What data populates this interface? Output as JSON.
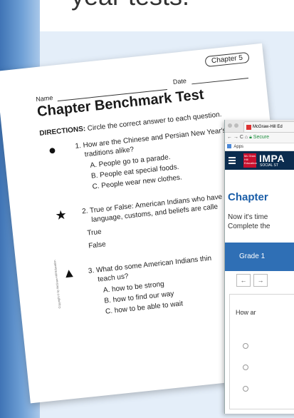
{
  "header_partial": "year tests.",
  "worksheet": {
    "chapter_tag": "Chapter 5",
    "date_label": "Date",
    "name_label": "Name",
    "title": "Chapter Benchmark Test",
    "directions_label": "DIRECTIONS:",
    "directions_text": "Circle the correct answer to each question.",
    "questions": [
      {
        "number": "1.",
        "text_line1": "How are the Chinese and Persian New Year's",
        "text_line2": "traditions alike?",
        "options": [
          "A. People go to a parade.",
          "B. People eat special foods.",
          "C. People wear new clothes."
        ],
        "icon": "apple-icon"
      },
      {
        "number": "2.",
        "text_line1": "True or False: American Indians who have",
        "text_line2": "language, customs, and beliefs are calle",
        "options": [
          "True",
          "False"
        ],
        "icon": "star-icon"
      },
      {
        "number": "3.",
        "text_line1": "What do some American Indians thin",
        "text_line2": "teach us?",
        "options": [
          "A. how to be strong",
          "B. how to find our way",
          "C. how to be able to wait"
        ],
        "icon": "tree-icon"
      }
    ],
    "copyright": "Copyright © by McGraw-Hill Education"
  },
  "browser": {
    "tab_title": "McGraw-Hill Ed",
    "address": "Secure",
    "apps_label": "Apps",
    "brand_logo_text": "Mc Graw Hill Education",
    "brand": "IMPA",
    "brand_sub": "SOCIAL ST",
    "page_title": "Chapter",
    "intro_line1": "Now it's time",
    "intro_line2": "Complete the",
    "grade_label": "Grade 1",
    "back_btn": "←",
    "fwd_btn": "→",
    "question_text": "How ar"
  }
}
